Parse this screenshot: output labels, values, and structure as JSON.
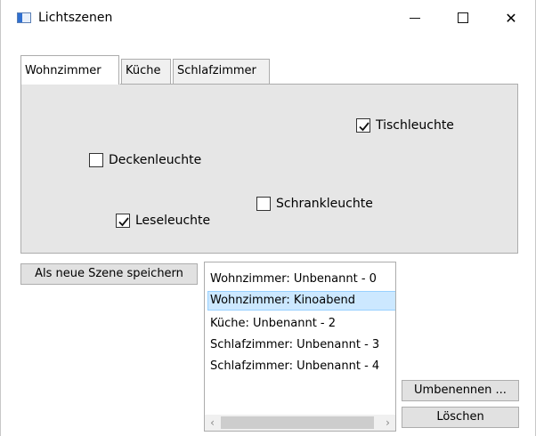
{
  "window": {
    "title": "Lichtszenen",
    "close_glyph": "✕"
  },
  "tabs": [
    {
      "label": "Wohnzimmer",
      "active": true
    },
    {
      "label": "Küche",
      "active": false
    },
    {
      "label": "Schlafzimmer",
      "active": false
    }
  ],
  "lights": {
    "tischleuchte": {
      "label": "Tischleuchte",
      "checked": true
    },
    "deckenleuchte": {
      "label": "Deckenleuchte",
      "checked": false
    },
    "schrankleuchte": {
      "label": "Schrankleuchte",
      "checked": false
    },
    "leseleuchte": {
      "label": "Leseleuchte",
      "checked": true
    }
  },
  "buttons": {
    "save": "Als neue Szene speichern",
    "rename": "Umbenennen ...",
    "delete": "Löschen"
  },
  "scenes": {
    "items": [
      "Wohnzimmer: Unbenannt - 0",
      "Wohnzimmer: Kinoabend",
      "Küche: Unbenannt - 2",
      "Schlafzimmer: Unbenannt - 3",
      "Schlafzimmer: Unbenannt - 4"
    ],
    "selected_index": 1
  },
  "scrollbar": {
    "left_glyph": "‹",
    "right_glyph": "›"
  },
  "colors": {
    "selection_bg": "#cce8ff",
    "tabpanel_bg": "#e6e6e6",
    "button_bg": "#e1e1e1"
  }
}
